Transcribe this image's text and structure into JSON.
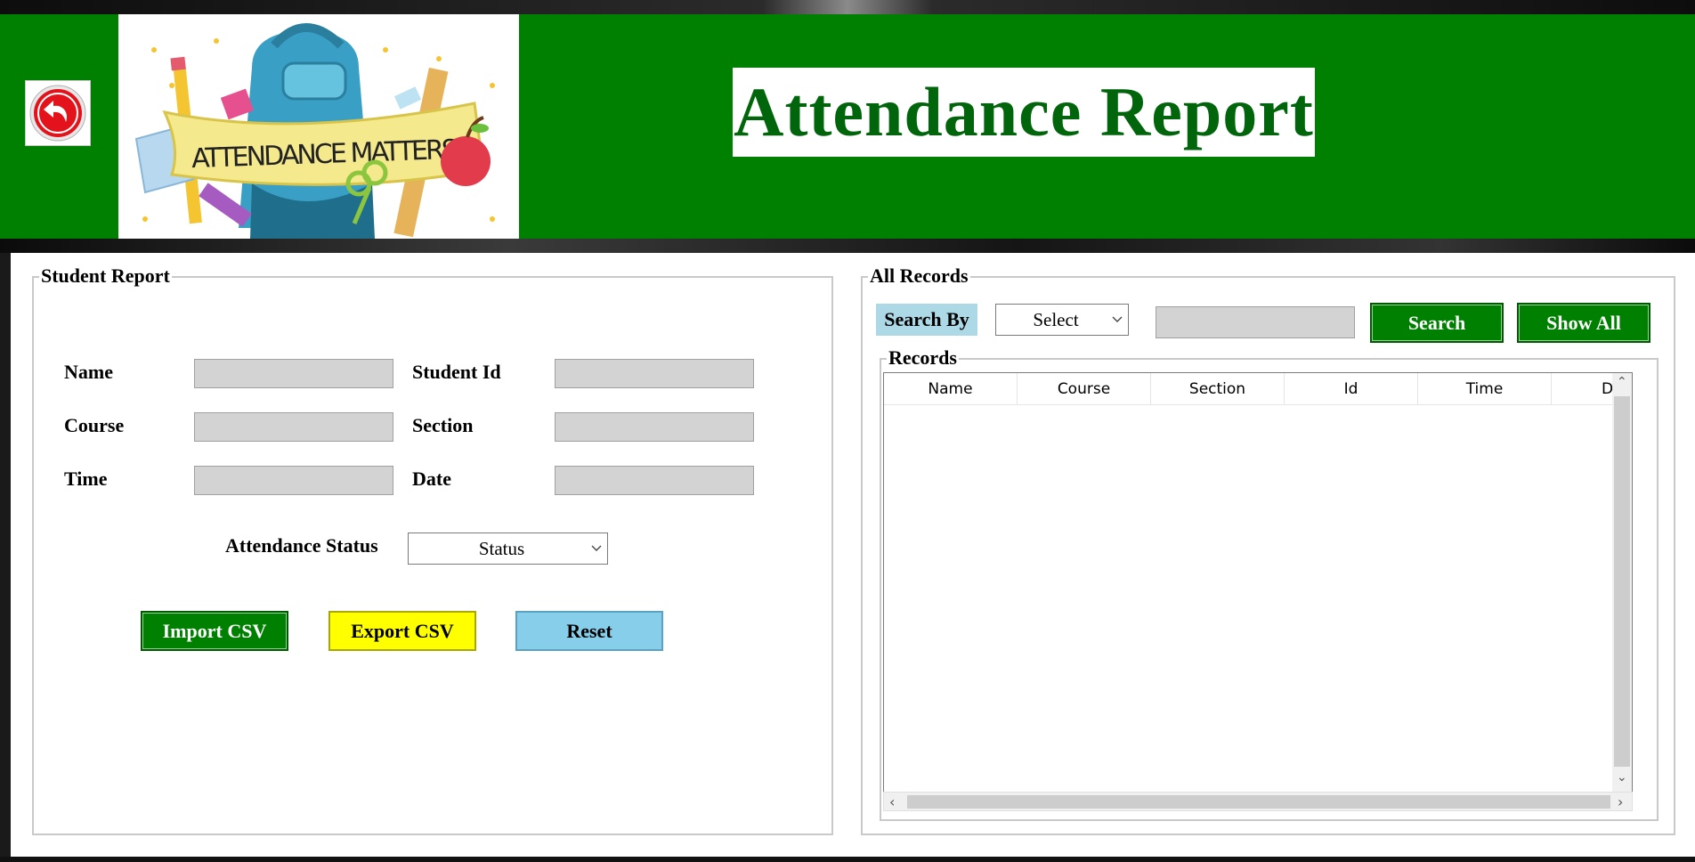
{
  "header": {
    "title": "Attendance Report",
    "logo_text": "ATTENDANCE MATTERS",
    "back_icon": "back-arrow-icon"
  },
  "student_report": {
    "group_title": "Student Report",
    "fields": {
      "name_label": "Name",
      "student_id_label": "Student Id",
      "course_label": "Course",
      "section_label": "Section",
      "time_label": "Time",
      "date_label": "Date",
      "name_value": "",
      "student_id_value": "",
      "course_value": "",
      "section_value": "",
      "time_value": "",
      "date_value": ""
    },
    "attendance_status_label": "Attendance Status",
    "status_selected": "Status",
    "buttons": {
      "import_csv": "Import CSV",
      "export_csv": "Export CSV",
      "reset": "Reset"
    }
  },
  "all_records": {
    "group_title": "All Records",
    "search_by_label": "Search By",
    "search_by_selected": "Select",
    "search_value": "",
    "search_button": "Search",
    "show_all_button": "Show All",
    "records_title": "Records",
    "columns": [
      "Name",
      "Course",
      "Section",
      "Id",
      "Time",
      "Date"
    ],
    "rows": []
  },
  "colors": {
    "header_green": "#008000",
    "title_green": "#00650b",
    "import_button": "#008000",
    "export_button": "#ffff00",
    "reset_button": "#87ceeb",
    "search_by_label_bg": "#add8e6",
    "textbox_gray": "#d3d3d3"
  }
}
